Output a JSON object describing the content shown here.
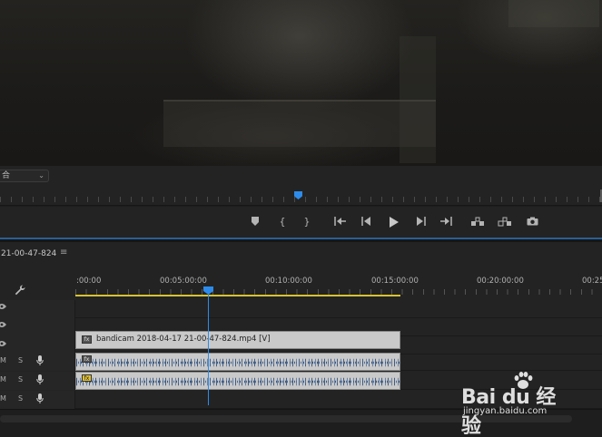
{
  "monitor": {
    "fit_label": "合"
  },
  "transport": {
    "marker_icon": "marker-icon",
    "in_icon": "mark-in-icon",
    "out_icon": "mark-out-icon",
    "goto_in_icon": "go-to-in-icon",
    "step_back_icon": "step-back-icon",
    "play_icon": "play-icon",
    "step_forward_icon": "step-forward-icon",
    "goto_out_icon": "go-to-out-icon",
    "lift_icon": "lift-icon",
    "extract_icon": "extract-icon",
    "export_frame_icon": "camera-icon"
  },
  "timeline": {
    "sequence_tab": "21-00-47-824",
    "menu_glyph": "≡",
    "time_labels": [
      ":00:00",
      "00:05:00:00",
      "00:10:00:00",
      "00:15:00:00",
      "00:20:00:00",
      "00:25"
    ],
    "tracks": {
      "v3": {},
      "v2": {},
      "v1": {
        "clip_name": "bandicam 2018-04-17 21-00-47-824.mp4 [V]",
        "fx": "fx"
      },
      "a1": {
        "m": "M",
        "s": "S",
        "fx": "fx"
      },
      "a2": {
        "m": "M",
        "s": "S",
        "fx": "fx"
      },
      "a3": {
        "m": "M",
        "s": "S"
      }
    }
  },
  "watermark": {
    "logo": "Bai  du 经验",
    "url": "jingyan.baidu.com"
  },
  "colors": {
    "accent_blue": "#2d8ceb",
    "work_area_yellow": "#d8c233",
    "clip_gray": "#c9c9c9"
  }
}
